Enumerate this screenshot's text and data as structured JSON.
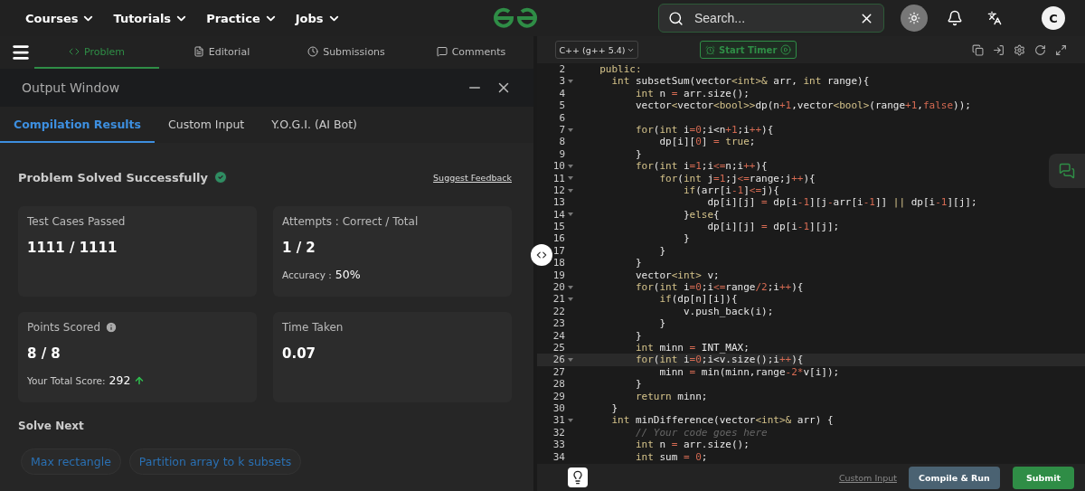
{
  "nav": {
    "menus": [
      "Courses",
      "Tutorials",
      "Practice",
      "Jobs"
    ],
    "search": {
      "placeholder": "Search..."
    },
    "avatar": "C"
  },
  "problem_tabs": [
    {
      "label": "Problem",
      "selected": true,
      "kind": "code"
    },
    {
      "label": "Editorial",
      "selected": false,
      "kind": "doc"
    },
    {
      "label": "Submissions",
      "selected": false,
      "kind": "clock"
    },
    {
      "label": "Comments",
      "selected": false,
      "kind": "chat"
    }
  ],
  "output_window": {
    "title": "Output Window",
    "tabs": [
      {
        "label": "Compilation Results",
        "selected": true
      },
      {
        "label": "Custom Input",
        "selected": false
      },
      {
        "label": "Y.O.G.I. (AI Bot)",
        "selected": false
      }
    ],
    "status": "Problem Solved Successfully",
    "feedback_link": "Suggest Feedback",
    "cards": [
      {
        "label": "Test Cases Passed",
        "value": "1111 / 1111",
        "info": false
      },
      {
        "label": "Attempts : Correct / Total",
        "value": "1 / 2",
        "info": false,
        "extra_label": "Accuracy :",
        "extra_value": "50%",
        "trend_up": false
      },
      {
        "label": "Points Scored",
        "value": "8 / 8",
        "info": true,
        "extra_label": "Your Total Score:",
        "extra_value": "292",
        "trend_up": true
      },
      {
        "label": "Time Taken",
        "value": "0.07",
        "info": false
      }
    ],
    "solve_next": {
      "title": "Solve Next",
      "items": [
        "Max rectangle",
        "Partition array to k subsets"
      ]
    }
  },
  "editor": {
    "language": "C++ (g++ 5.4)",
    "timer_button": "Start Timer",
    "lines": [
      {
        "n": "2",
        "fold": false,
        "active": false,
        "t": [
          {
            "kind": "kw",
            "text": "  public:"
          }
        ]
      },
      {
        "n": "3",
        "fold": true,
        "active": false,
        "t": [
          {
            "kind": "kw",
            "text": "    int"
          },
          {
            "kind": "plain",
            "text": " subsetSum(vector"
          },
          {
            "kind": "kw",
            "text": "<int>&"
          },
          {
            "kind": "plain",
            "text": " arr, "
          },
          {
            "kind": "kw",
            "text": "int"
          },
          {
            "kind": "plain",
            "text": " range){"
          }
        ]
      },
      {
        "n": "4",
        "fold": false,
        "active": false,
        "t": [
          {
            "kind": "kw",
            "text": "        int"
          },
          {
            "kind": "plain",
            "text": " n "
          },
          {
            "kind": "op",
            "text": "="
          },
          {
            "kind": "plain",
            "text": " arr.size();"
          }
        ]
      },
      {
        "n": "5",
        "fold": false,
        "active": false,
        "t": [
          {
            "kind": "plain",
            "text": "        vector"
          },
          {
            "kind": "kw",
            "text": "<"
          },
          {
            "kind": "plain",
            "text": "vector"
          },
          {
            "kind": "kw",
            "text": "<bool>>"
          },
          {
            "kind": "plain",
            "text": "dp(n"
          },
          {
            "kind": "op",
            "text": "+1"
          },
          {
            "kind": "plain",
            "text": ",vector"
          },
          {
            "kind": "kw",
            "text": "<bool>"
          },
          {
            "kind": "plain",
            "text": "(range"
          },
          {
            "kind": "op",
            "text": "+1"
          },
          {
            "kind": "plain",
            "text": ","
          },
          {
            "kind": "op",
            "text": "false"
          },
          {
            "kind": "plain",
            "text": "));"
          }
        ]
      },
      {
        "n": "6",
        "fold": false,
        "active": false
      },
      {
        "n": "7",
        "fold": true,
        "active": false,
        "t": [
          {
            "kind": "kw",
            "text": "        for"
          },
          {
            "kind": "plain",
            "text": "("
          },
          {
            "kind": "kw",
            "text": "int"
          },
          {
            "kind": "plain",
            "text": " i"
          },
          {
            "kind": "op",
            "text": "=0"
          },
          {
            "kind": "plain",
            "text": ";i<n"
          },
          {
            "kind": "op",
            "text": "+1"
          },
          {
            "kind": "plain",
            "text": ";i"
          },
          {
            "kind": "op",
            "text": "++"
          },
          {
            "kind": "plain",
            "text": "){"
          }
        ]
      },
      {
        "n": "8",
        "fold": false,
        "active": false,
        "t": [
          {
            "kind": "plain",
            "text": "            dp[i]["
          },
          {
            "kind": "op",
            "text": "0"
          },
          {
            "kind": "plain",
            "text": "] "
          },
          {
            "kind": "op",
            "text": "="
          },
          {
            "kind": "kw",
            "text": " true"
          },
          {
            "kind": "plain",
            "text": ";"
          }
        ]
      },
      {
        "n": "9",
        "fold": false,
        "active": false,
        "t": [
          {
            "kind": "plain",
            "text": "        }"
          }
        ]
      },
      {
        "n": "10",
        "fold": true,
        "active": false,
        "t": [
          {
            "kind": "kw",
            "text": "        for"
          },
          {
            "kind": "plain",
            "text": "("
          },
          {
            "kind": "kw",
            "text": "int"
          },
          {
            "kind": "plain",
            "text": " i"
          },
          {
            "kind": "op",
            "text": "=1"
          },
          {
            "kind": "plain",
            "text": ";i"
          },
          {
            "kind": "op",
            "text": "<="
          },
          {
            "kind": "plain",
            "text": "n;i"
          },
          {
            "kind": "op",
            "text": "++"
          },
          {
            "kind": "plain",
            "text": "){"
          }
        ]
      },
      {
        "n": "11",
        "fold": true,
        "active": false,
        "t": [
          {
            "kind": "kw",
            "text": "            for"
          },
          {
            "kind": "plain",
            "text": "("
          },
          {
            "kind": "kw",
            "text": "int"
          },
          {
            "kind": "plain",
            "text": " j"
          },
          {
            "kind": "op",
            "text": "=1"
          },
          {
            "kind": "plain",
            "text": ";j"
          },
          {
            "kind": "op",
            "text": "<="
          },
          {
            "kind": "plain",
            "text": "range;j"
          },
          {
            "kind": "op",
            "text": "++"
          },
          {
            "kind": "plain",
            "text": "){"
          }
        ]
      },
      {
        "n": "12",
        "fold": true,
        "active": false,
        "t": [
          {
            "kind": "kw",
            "text": "                if"
          },
          {
            "kind": "plain",
            "text": "(arr[i"
          },
          {
            "kind": "op",
            "text": "-1"
          },
          {
            "kind": "plain",
            "text": "]"
          },
          {
            "kind": "op",
            "text": "<="
          },
          {
            "kind": "plain",
            "text": "j){"
          }
        ]
      },
      {
        "n": "13",
        "fold": false,
        "active": false,
        "t": [
          {
            "kind": "plain",
            "text": "                    dp[i][j] "
          },
          {
            "kind": "op",
            "text": "="
          },
          {
            "kind": "plain",
            "text": " dp[i"
          },
          {
            "kind": "op",
            "text": "-1"
          },
          {
            "kind": "plain",
            "text": "][j"
          },
          {
            "kind": "op",
            "text": "-"
          },
          {
            "kind": "plain",
            "text": "arr[i"
          },
          {
            "kind": "op",
            "text": "-1"
          },
          {
            "kind": "plain",
            "text": "]] "
          },
          {
            "kind": "kw",
            "text": "||"
          },
          {
            "kind": "plain",
            "text": " dp[i"
          },
          {
            "kind": "op",
            "text": "-1"
          },
          {
            "kind": "plain",
            "text": "][j];"
          }
        ]
      },
      {
        "n": "14",
        "fold": true,
        "active": false,
        "t": [
          {
            "kind": "plain",
            "text": "                }"
          },
          {
            "kind": "kw",
            "text": "else"
          },
          {
            "kind": "plain",
            "text": "{"
          }
        ]
      },
      {
        "n": "15",
        "fold": false,
        "active": false,
        "t": [
          {
            "kind": "plain",
            "text": "                    dp[i][j] "
          },
          {
            "kind": "op",
            "text": "="
          },
          {
            "kind": "plain",
            "text": " dp[i"
          },
          {
            "kind": "op",
            "text": "-1"
          },
          {
            "kind": "plain",
            "text": "][j];"
          }
        ]
      },
      {
        "n": "16",
        "fold": false,
        "active": false,
        "t": [
          {
            "kind": "plain",
            "text": "                }"
          }
        ]
      },
      {
        "n": "17",
        "fold": false,
        "active": false,
        "t": [
          {
            "kind": "plain",
            "text": "            }"
          }
        ]
      },
      {
        "n": "18",
        "fold": false,
        "active": false,
        "t": [
          {
            "kind": "plain",
            "text": "        }"
          }
        ]
      },
      {
        "n": "19",
        "fold": false,
        "active": false,
        "t": [
          {
            "kind": "plain",
            "text": "        vector"
          },
          {
            "kind": "kw",
            "text": "<int>"
          },
          {
            "kind": "plain",
            "text": " v;"
          }
        ]
      },
      {
        "n": "20",
        "fold": true,
        "active": false,
        "t": [
          {
            "kind": "kw",
            "text": "        for"
          },
          {
            "kind": "plain",
            "text": "("
          },
          {
            "kind": "kw",
            "text": "int"
          },
          {
            "kind": "plain",
            "text": " i"
          },
          {
            "kind": "op",
            "text": "=0"
          },
          {
            "kind": "plain",
            "text": ";i"
          },
          {
            "kind": "op",
            "text": "<="
          },
          {
            "kind": "plain",
            "text": "range"
          },
          {
            "kind": "op",
            "text": "/2"
          },
          {
            "kind": "plain",
            "text": ";i"
          },
          {
            "kind": "op",
            "text": "++"
          },
          {
            "kind": "plain",
            "text": "){"
          }
        ]
      },
      {
        "n": "21",
        "fold": true,
        "active": false,
        "t": [
          {
            "kind": "kw",
            "text": "            if"
          },
          {
            "kind": "plain",
            "text": "(dp[n][i]){"
          }
        ]
      },
      {
        "n": "22",
        "fold": false,
        "active": false,
        "t": [
          {
            "kind": "plain",
            "text": "                v.push_back(i);"
          }
        ]
      },
      {
        "n": "23",
        "fold": false,
        "active": false,
        "t": [
          {
            "kind": "plain",
            "text": "            }"
          }
        ]
      },
      {
        "n": "24",
        "fold": false,
        "active": false,
        "t": [
          {
            "kind": "plain",
            "text": "        }"
          }
        ]
      },
      {
        "n": "25",
        "fold": false,
        "active": false,
        "t": [
          {
            "kind": "kw",
            "text": "        int"
          },
          {
            "kind": "plain",
            "text": " minn "
          },
          {
            "kind": "op",
            "text": "="
          },
          {
            "kind": "plain",
            "text": " INT_MAX;"
          }
        ]
      },
      {
        "n": "26",
        "fold": true,
        "active": true,
        "t": [
          {
            "kind": "kw",
            "text": "        for"
          },
          {
            "kind": "plain",
            "text": "("
          },
          {
            "kind": "kw",
            "text": "int"
          },
          {
            "kind": "plain",
            "text": " i"
          },
          {
            "kind": "op",
            "text": "=0"
          },
          {
            "kind": "plain",
            "text": ";i<v.size();i"
          },
          {
            "kind": "op",
            "text": "++"
          },
          {
            "kind": "plain",
            "text": "){"
          }
        ]
      },
      {
        "n": "27",
        "fold": false,
        "active": false,
        "t": [
          {
            "kind": "plain",
            "text": "            minn "
          },
          {
            "kind": "op",
            "text": "="
          },
          {
            "kind": "plain",
            "text": " min(minn,range"
          },
          {
            "kind": "op",
            "text": "-2*"
          },
          {
            "kind": "plain",
            "text": "v[i]);"
          }
        ]
      },
      {
        "n": "28",
        "fold": false,
        "active": false,
        "t": [
          {
            "kind": "plain",
            "text": "        }"
          }
        ]
      },
      {
        "n": "29",
        "fold": false,
        "active": false,
        "t": [
          {
            "kind": "kw",
            "text": "        return"
          },
          {
            "kind": "plain",
            "text": " minn;"
          }
        ]
      },
      {
        "n": "30",
        "fold": false,
        "active": false,
        "t": [
          {
            "kind": "plain",
            "text": "    }"
          }
        ]
      },
      {
        "n": "31",
        "fold": true,
        "active": false,
        "t": [
          {
            "kind": "kw",
            "text": "    int"
          },
          {
            "kind": "plain",
            "text": " minDifference(vector"
          },
          {
            "kind": "kw",
            "text": "<int>&"
          },
          {
            "kind": "plain",
            "text": " arr) {"
          }
        ]
      },
      {
        "n": "32",
        "fold": false,
        "active": false,
        "t": [
          {
            "kind": "comment",
            "text": "        // Your code goes here"
          }
        ]
      },
      {
        "n": "33",
        "fold": false,
        "active": false,
        "t": [
          {
            "kind": "kw",
            "text": "        int"
          },
          {
            "kind": "plain",
            "text": " n "
          },
          {
            "kind": "op",
            "text": "="
          },
          {
            "kind": "plain",
            "text": " arr.size();"
          }
        ]
      },
      {
        "n": "34",
        "fold": false,
        "active": false,
        "t": [
          {
            "kind": "kw",
            "text": "        int"
          },
          {
            "kind": "plain",
            "text": " sum "
          },
          {
            "kind": "op",
            "text": "= 0"
          },
          {
            "kind": "plain",
            "text": ";"
          }
        ]
      }
    ],
    "custom_input_link": "Custom Input",
    "run_button": "Compile & Run",
    "submit_button": "Submit"
  }
}
